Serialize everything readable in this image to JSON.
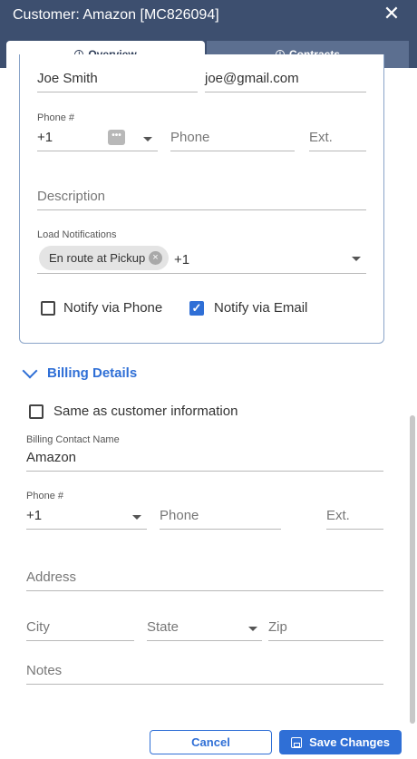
{
  "window": {
    "title": "Customer: Amazon [MC826094]"
  },
  "tabs": {
    "overview": "Overview",
    "contracts": "Contracts"
  },
  "contact": {
    "name": "Joe Smith",
    "email": "joe@gmail.com",
    "phone_label": "Phone #",
    "country_code": "+1",
    "phone_placeholder": "Phone",
    "ext_placeholder": "Ext.",
    "description_placeholder": "Description",
    "load_notifications_label": "Load Notifications",
    "notification_chip": "En route at Pickup",
    "notification_more": "+1",
    "notify_phone_label": "Notify via Phone",
    "notify_phone_checked": false,
    "notify_email_label": "Notify via Email",
    "notify_email_checked": true
  },
  "billing": {
    "section_title": "Billing Details",
    "same_as_label": "Same as customer information",
    "same_as_checked": false,
    "contact_name_label": "Billing Contact Name",
    "contact_name": "Amazon",
    "phone_label": "Phone #",
    "country_code": "+1",
    "phone_placeholder": "Phone",
    "ext_placeholder": "Ext.",
    "address_placeholder": "Address",
    "city_placeholder": "City",
    "state_placeholder": "State",
    "zip_placeholder": "Zip",
    "notes_placeholder": "Notes"
  },
  "footer": {
    "cancel_label": "Cancel",
    "save_label": "Save Changes"
  },
  "colors": {
    "header": "#3d4f6f",
    "accent": "#2f6fd6",
    "tab_inactive": "#5c6f90"
  }
}
